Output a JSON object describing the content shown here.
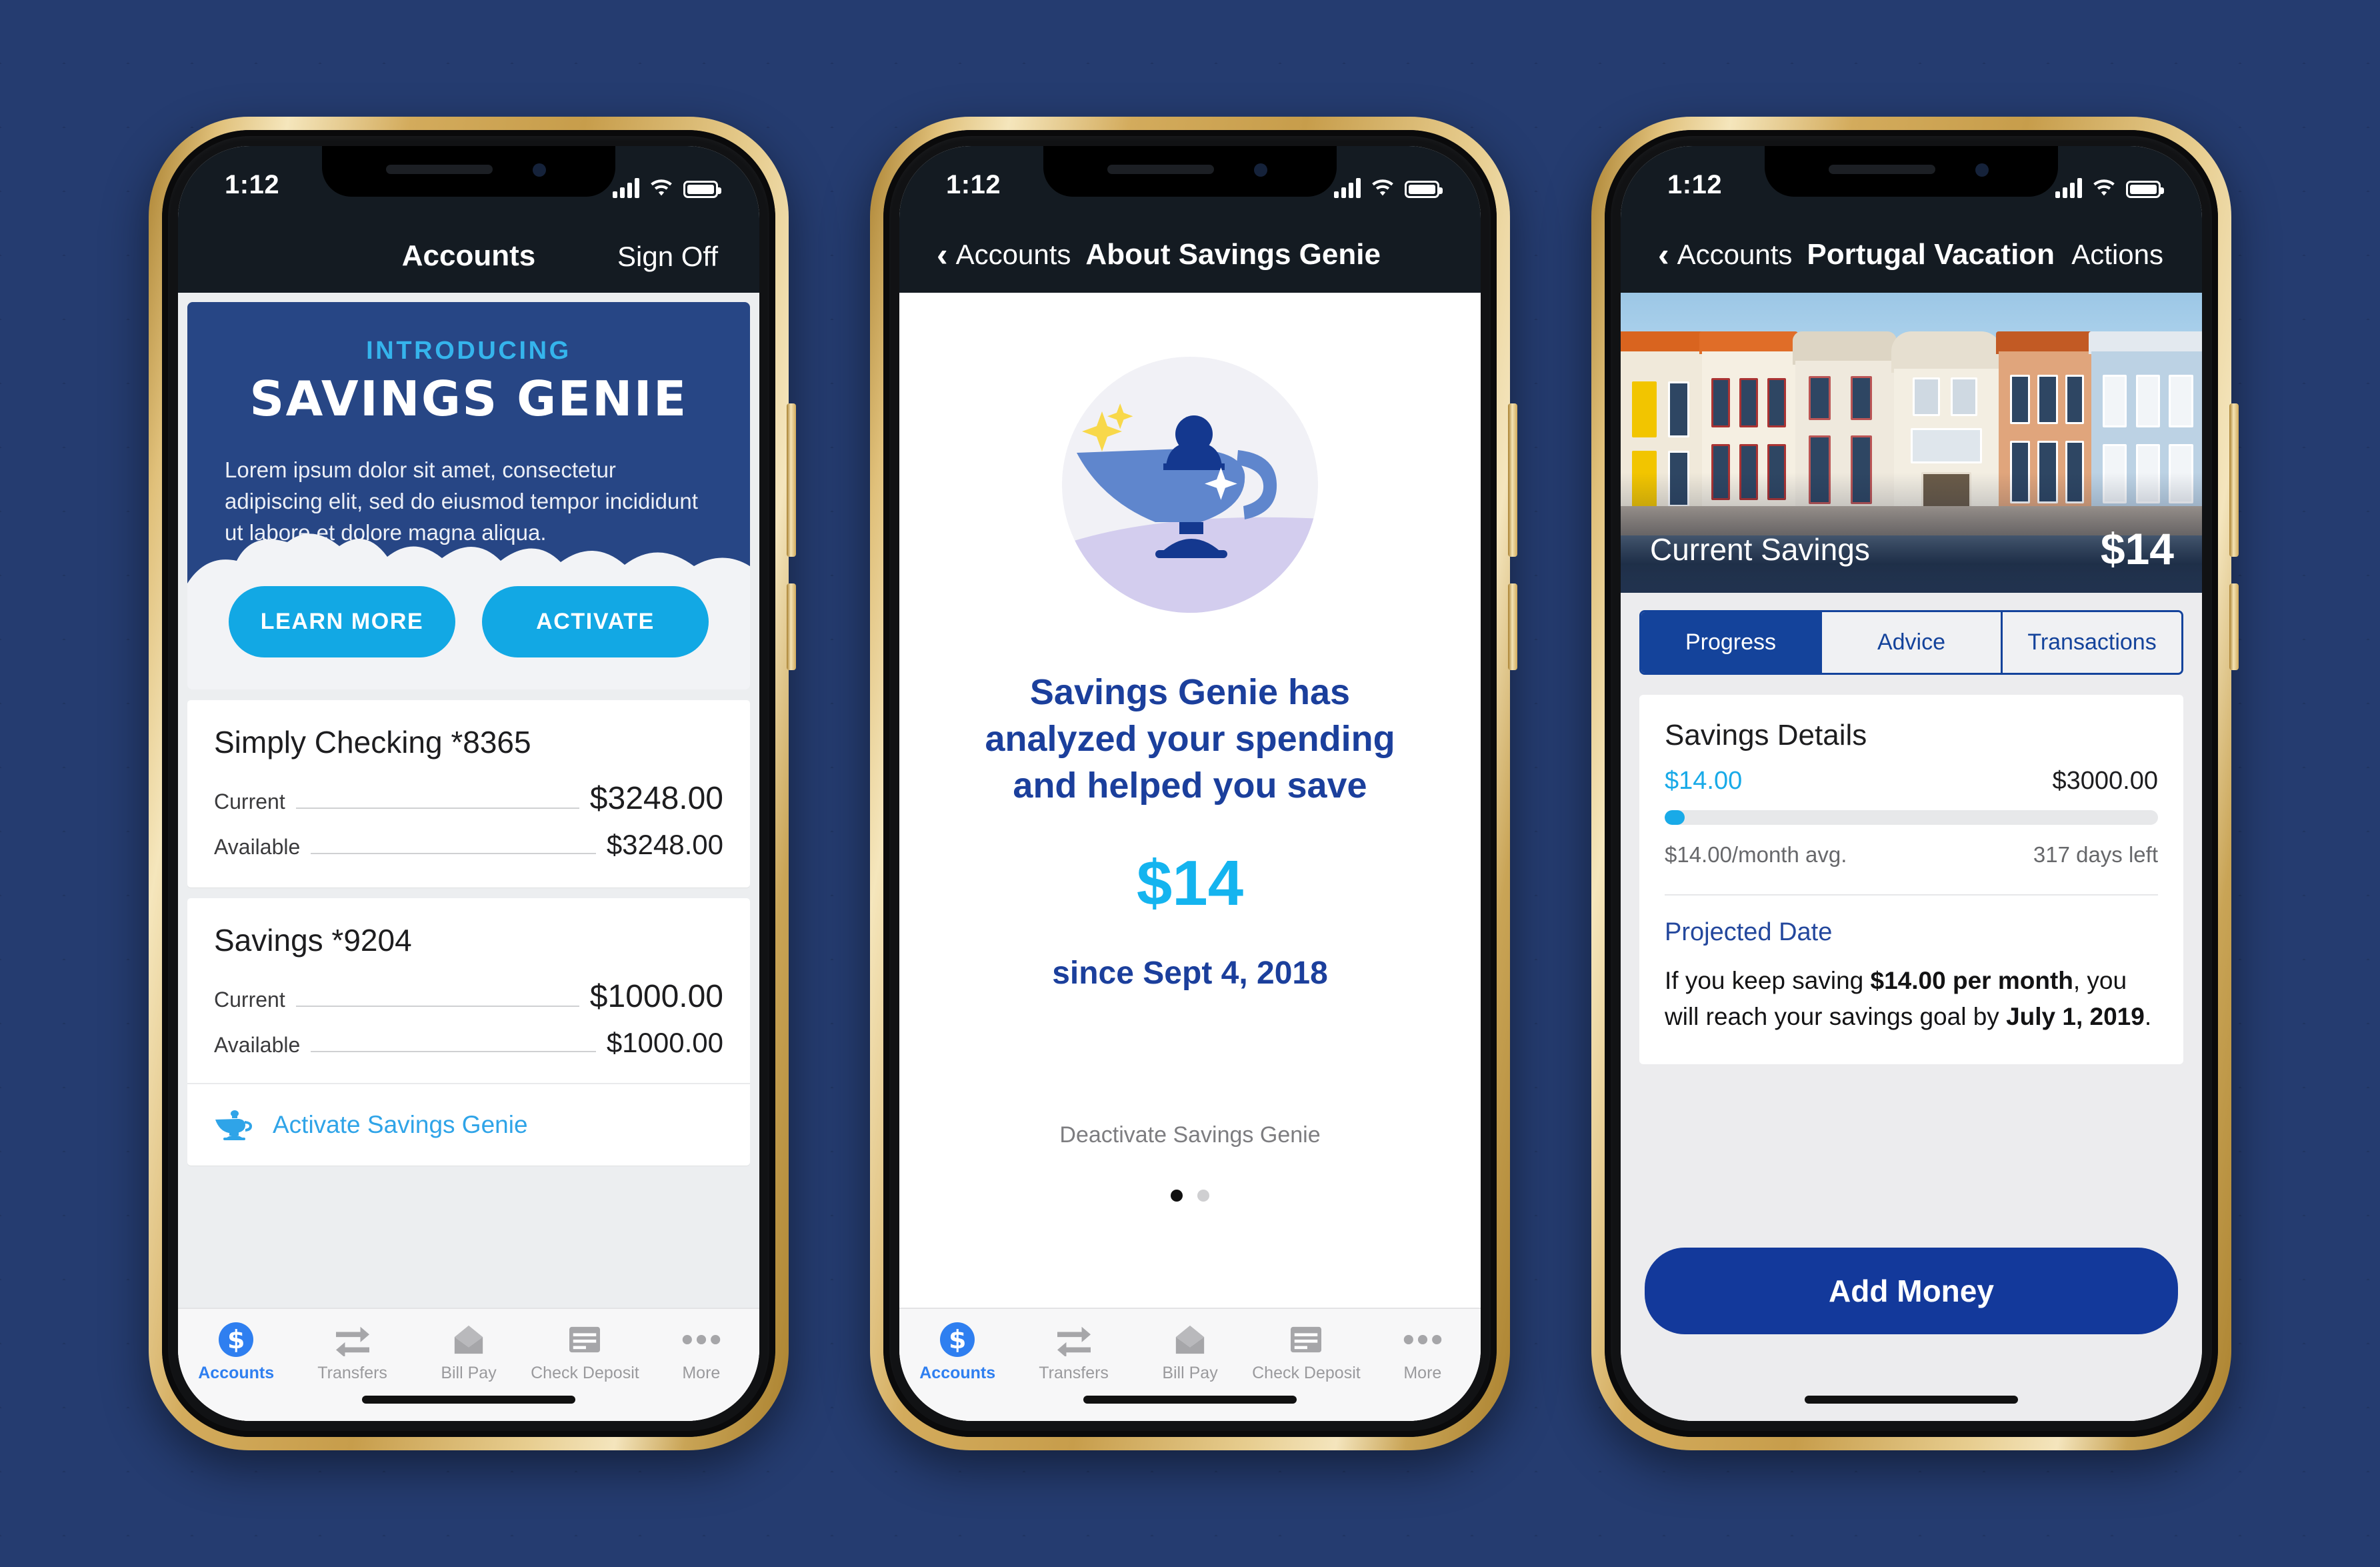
{
  "phones": [
    {
      "status": {
        "time": "1:12",
        "signal_icon": "signal-bars-icon",
        "wifi_icon": "wifi-icon",
        "battery_icon": "battery-full-icon"
      },
      "nav": {
        "title": "Accounts",
        "right_action": "Sign Off"
      },
      "promo": {
        "eyebrow": "INTRODUCING",
        "brand": "SAVINGS GENIE",
        "body": "Lorem ipsum dolor sit amet, consectetur adipiscing elit, sed do eiusmod tempor incididunt ut labore et dolore magna aliqua.",
        "learn_more": "LEARN MORE",
        "activate": "ACTIVATE",
        "bg_color": "#274685",
        "accent_color": "#12a8e4"
      },
      "accounts": [
        {
          "name": "Simply Checking *8365",
          "current_label": "Current",
          "current_value": "$3248.00",
          "available_label": "Available",
          "available_value": "$3248.00"
        },
        {
          "name": "Savings *9204",
          "current_label": "Current",
          "current_value": "$1000.00",
          "available_label": "Available",
          "available_value": "$1000.00"
        }
      ],
      "genie_cta": {
        "icon": "genie-lamp-icon",
        "label": "Activate Savings Genie",
        "color": "#2fa4e8"
      },
      "tabs": [
        {
          "label": "Accounts",
          "icon": "dollar-circle-icon",
          "active": true
        },
        {
          "label": "Transfers",
          "icon": "transfer-arrows-icon",
          "active": false
        },
        {
          "label": "Bill Pay",
          "icon": "envelope-icon",
          "active": false
        },
        {
          "label": "Check Deposit",
          "icon": "check-icon",
          "active": false
        },
        {
          "label": "More",
          "icon": "ellipsis-icon",
          "active": false
        }
      ]
    },
    {
      "status": {
        "time": "1:12",
        "signal_icon": "signal-bars-icon",
        "wifi_icon": "wifi-icon",
        "battery_icon": "battery-full-icon"
      },
      "nav": {
        "back_label": "Accounts",
        "back_icon": "chevron-left-icon",
        "title": "About Savings Genie"
      },
      "illustration": {
        "icon": "genie-lamp-illustration",
        "lamp_color": "#5f86cd",
        "figure_color": "#15388f",
        "sparkle_color": "#f8d84a"
      },
      "headline": "Savings Genie has analyzed your spending and helped you save",
      "amount": "$14",
      "since": "since Sept 4, 2018",
      "deactivate": "Deactivate Savings Genie",
      "pager": {
        "total": 2,
        "active_index": 0
      },
      "tabs": [
        {
          "label": "Accounts",
          "icon": "dollar-circle-icon",
          "active": true
        },
        {
          "label": "Transfers",
          "icon": "transfer-arrows-icon",
          "active": false
        },
        {
          "label": "Bill Pay",
          "icon": "envelope-icon",
          "active": false
        },
        {
          "label": "Check Deposit",
          "icon": "check-icon",
          "active": false
        },
        {
          "label": "More",
          "icon": "ellipsis-icon",
          "active": false
        }
      ]
    },
    {
      "status": {
        "time": "1:12",
        "signal_icon": "signal-bars-icon",
        "wifi_icon": "wifi-icon",
        "battery_icon": "battery-full-icon"
      },
      "nav": {
        "back_label": "Accounts",
        "back_icon": "chevron-left-icon",
        "title": "Portugal Vacation",
        "right_action": "Actions"
      },
      "hero": {
        "savings_label": "Current Savings",
        "savings_amount": "$14"
      },
      "segments": [
        {
          "label": "Progress",
          "active": true
        },
        {
          "label": "Advice",
          "active": false
        },
        {
          "label": "Transactions",
          "active": false
        }
      ],
      "details": {
        "title": "Savings Details",
        "current": "$14.00",
        "goal": "$3000.00",
        "progress_percent": 4,
        "monthly_avg": "$14.00/month avg.",
        "days_left": "317 days left",
        "projected_title": "Projected Date",
        "projected_prefix": "If you keep saving ",
        "projected_rate": "$14.00 per month",
        "projected_mid": ", you will reach your savings goal by ",
        "projected_date": "July 1, 2019",
        "projected_suffix": "."
      },
      "add_money": "Add Money"
    }
  ]
}
